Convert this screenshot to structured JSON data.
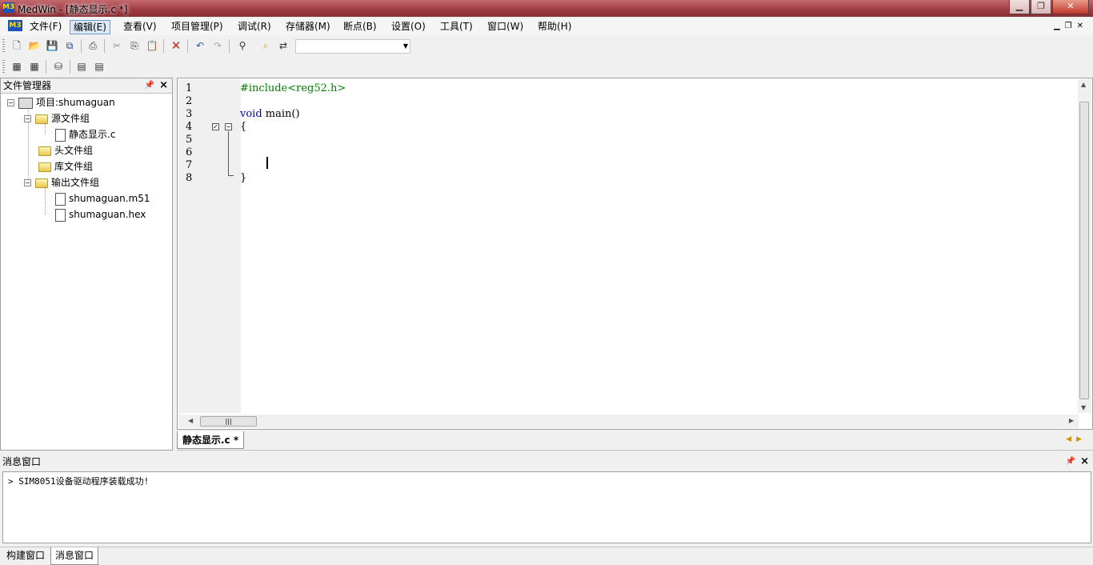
{
  "window": {
    "title": "MedWin - [静态显示.c *]",
    "app_logo": "M3"
  },
  "menu": {
    "items": [
      "文件(F)",
      "编辑(E)",
      "查看(V)",
      "项目管理(P)",
      "调试(R)",
      "存储器(M)",
      "断点(B)",
      "设置(O)",
      "工具(T)",
      "窗口(W)",
      "帮助(H)"
    ],
    "active_index": 1
  },
  "toolbar": {
    "combo_value": ""
  },
  "file_panel": {
    "title": "文件管理器",
    "project": "项目:shumaguan",
    "groups": {
      "source": "源文件组",
      "source_file": "静态显示.c",
      "header": "头文件组",
      "library": "库文件组",
      "output": "输出文件组",
      "output_files": [
        "shumaguan.m51",
        "shumaguan.hex"
      ]
    }
  },
  "editor": {
    "line_numbers": [
      "1",
      "2",
      "3",
      "4",
      "5",
      "6",
      "7",
      "8"
    ],
    "code": {
      "l1": "#include<reg52.h>",
      "l3_kw": "void",
      "l3_rest": " main()",
      "l4": "{",
      "l8": "}"
    }
  },
  "tabs": {
    "active": "静态显示.c *"
  },
  "message_panel": {
    "title": "消息窗口",
    "messages": [
      "> SIM8051设备驱动程序装载成功!"
    ]
  },
  "bottom_tabs": [
    "构建窗口",
    "消息窗口"
  ],
  "colors": {
    "title_bar": "#9c3a40",
    "preprocessor": "#008000",
    "keyword": "#0000c0"
  }
}
